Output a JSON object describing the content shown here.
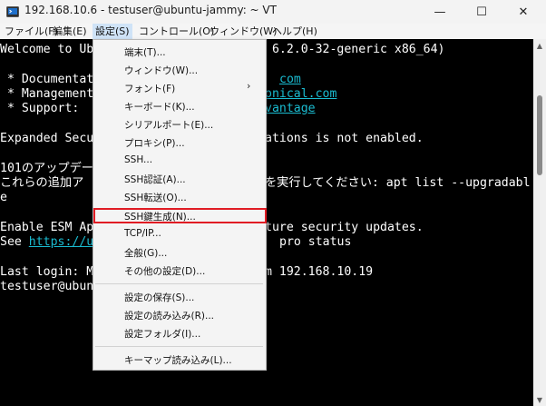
{
  "window": {
    "title": "192.168.10.6 - testuser@ubuntu-jammy: ~ VT",
    "minimize": "—",
    "maximize": "☐",
    "close": "✕"
  },
  "menubar": [
    "ファイル(F)",
    "編集(E)",
    "設定(S)",
    "コントロール(O)",
    "ウィンドウ(W)",
    "ヘルプ(H)"
  ],
  "terminal": {
    "lines": [
      {
        "text": "Welcome to Ubu"
      },
      {
        "text": " * Documentati"
      },
      {
        "text": " * Management:"
      },
      {
        "text": " * Support:"
      },
      {
        "text": "Expanded Secur"
      },
      {
        "text": "101のアップデー"
      },
      {
        "text": "これらの追加ア"
      },
      {
        "text": "e"
      },
      {
        "text": "Enable ESM App"
      },
      {
        "text": "See ",
        "link": "https://ub"
      },
      {
        "text": "Last login: Mo"
      },
      {
        "text": "testuser@ubunt"
      }
    ],
    "right": [
      {
        "text": " 6.2.0-32-generic x86_64)"
      },
      {
        "link": "com"
      },
      {
        "link": "onical.com"
      },
      {
        "link": "vantage"
      },
      {
        "text": "ations is not enabled."
      },
      {
        "text": "を実行してください: apt list --upgradabl"
      },
      {
        "text": "ture security updates."
      },
      {
        "text": "pro status"
      },
      {
        "text": "m 192.168.10.19"
      }
    ]
  },
  "settings_menu": {
    "items": [
      "端末(T)...",
      "ウィンドウ(W)...",
      "フォント(F)",
      "キーボード(K)...",
      "シリアルポート(E)...",
      "プロキシ(P)...",
      "SSH...",
      "SSH認証(A)...",
      "SSH転送(O)...",
      "SSH鍵生成(N)...",
      "TCP/IP...",
      "全般(G)...",
      "その他の設定(D)...",
      "設定の保存(S)...",
      "設定の読み込み(R)...",
      "設定フォルダ(I)...",
      "キーマップ読み込み(L)..."
    ],
    "submenu_arrow": "›",
    "highlighted_item": "SSH鍵生成(N)...",
    "highlight_color": "#e01c24"
  },
  "icons": {
    "app": "tera-term-icon"
  }
}
